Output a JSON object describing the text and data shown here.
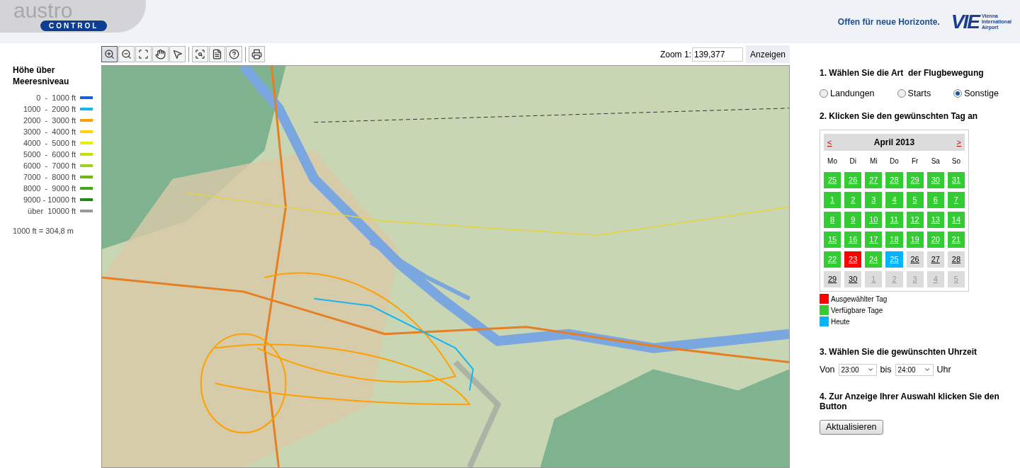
{
  "header": {
    "logo_word": "austro",
    "logo_badge": "CONTROL",
    "slogan": "Offen für neue Horizonte.",
    "airport_logo": "VIE",
    "airport_name": [
      "Vienna",
      "International",
      "Airport"
    ]
  },
  "legend": {
    "title": "Höhe über Meeresniveau",
    "items": [
      {
        "label": "0  -  1000 ft",
        "color": "#1a5fd6"
      },
      {
        "label": "1000  -  2000 ft",
        "color": "#1ab4ef"
      },
      {
        "label": "2000  -  3000 ft",
        "color": "#ffa000"
      },
      {
        "label": "3000  -  4000 ft",
        "color": "#ffd200"
      },
      {
        "label": "4000  -  5000 ft",
        "color": "#e8ee00"
      },
      {
        "label": "5000  -  6000 ft",
        "color": "#c4e000"
      },
      {
        "label": "6000  -  7000 ft",
        "color": "#9ed21e"
      },
      {
        "label": "7000  -  8000 ft",
        "color": "#6eb814"
      },
      {
        "label": "8000  -  9000 ft",
        "color": "#44a814"
      },
      {
        "label": "9000 - 10000 ft",
        "color": "#1e8c14"
      },
      {
        "label": "über  10000 ft",
        "color": "#999999"
      }
    ],
    "note": "1000 ft = 304,8 m"
  },
  "toolbar": {
    "tools": [
      {
        "kind": "zoom_in",
        "selected": true
      },
      {
        "kind": "zoom_out",
        "selected": false
      },
      {
        "kind": "full_extent",
        "selected": false
      },
      {
        "kind": "pan",
        "selected": false
      },
      {
        "kind": "pointer",
        "selected": false
      },
      {
        "kind": "separator"
      },
      {
        "kind": "identify",
        "selected": false
      },
      {
        "kind": "list",
        "selected": false
      },
      {
        "kind": "help",
        "selected": false
      },
      {
        "kind": "separator"
      },
      {
        "kind": "print",
        "selected": false
      }
    ],
    "zoom_label": "Zoom 1:",
    "zoom_value": "139,377",
    "zoom_button": "Anzeigen"
  },
  "panel": {
    "step1": "1. Wählen Sie die Art  der Flugbewegung",
    "movement_types": [
      {
        "label": "Landungen",
        "selected": false
      },
      {
        "label": "Starts",
        "selected": false
      },
      {
        "label": "Sonstige",
        "selected": true
      }
    ],
    "step2": "2. Klicken Sie den gewünschten Tag an",
    "calendar": {
      "prev": "<",
      "title": "April 2013",
      "next": ">",
      "weekdays": [
        "Mo",
        "Di",
        "Mi",
        "Do",
        "Fr",
        "Sa",
        "So"
      ],
      "days": [
        {
          "label": "25",
          "kind": "available"
        },
        {
          "label": "26",
          "kind": "available"
        },
        {
          "label": "27",
          "kind": "available"
        },
        {
          "label": "28",
          "kind": "available"
        },
        {
          "label": "29",
          "kind": "available"
        },
        {
          "label": "30",
          "kind": "available"
        },
        {
          "label": "31",
          "kind": "available"
        },
        {
          "label": "1",
          "kind": "available"
        },
        {
          "label": "2",
          "kind": "available"
        },
        {
          "label": "3",
          "kind": "available"
        },
        {
          "label": "4",
          "kind": "available"
        },
        {
          "label": "5",
          "kind": "available"
        },
        {
          "label": "6",
          "kind": "available"
        },
        {
          "label": "7",
          "kind": "available"
        },
        {
          "label": "8",
          "kind": "available"
        },
        {
          "label": "9",
          "kind": "available"
        },
        {
          "label": "10",
          "kind": "available"
        },
        {
          "label": "11",
          "kind": "available"
        },
        {
          "label": "12",
          "kind": "available"
        },
        {
          "label": "13",
          "kind": "available"
        },
        {
          "label": "14",
          "kind": "available"
        },
        {
          "label": "15",
          "kind": "available"
        },
        {
          "label": "16",
          "kind": "available"
        },
        {
          "label": "17",
          "kind": "available"
        },
        {
          "label": "18",
          "kind": "available"
        },
        {
          "label": "19",
          "kind": "available"
        },
        {
          "label": "20",
          "kind": "available"
        },
        {
          "label": "21",
          "kind": "available"
        },
        {
          "label": "22",
          "kind": "available"
        },
        {
          "label": "23",
          "kind": "selected"
        },
        {
          "label": "24",
          "kind": "available"
        },
        {
          "label": "25",
          "kind": "today"
        },
        {
          "label": "26",
          "kind": "unavailable"
        },
        {
          "label": "27",
          "kind": "unavailable"
        },
        {
          "label": "28",
          "kind": "unavailable"
        },
        {
          "label": "29",
          "kind": "unavailable"
        },
        {
          "label": "30",
          "kind": "unavailable"
        },
        {
          "label": "1",
          "kind": "other_month"
        },
        {
          "label": "2",
          "kind": "other_month"
        },
        {
          "label": "3",
          "kind": "other_month"
        },
        {
          "label": "4",
          "kind": "other_month"
        },
        {
          "label": "5",
          "kind": "other_month"
        }
      ]
    },
    "calendar_legend": [
      {
        "label": "Ausgewählter Tag",
        "color": "#ff0000"
      },
      {
        "label": "Verfügbare Tage",
        "color": "#33cc33"
      },
      {
        "label": "Heute",
        "color": "#00b4ff"
      }
    ],
    "step3": "3. Wählen Sie die gewünschten Uhrzeit",
    "from_label": "Von",
    "from_value": "23:00",
    "to_label": "bis",
    "to_value": "24:00",
    "unit": "Uhr",
    "step4": "4. Zur Anzeige Ihrer Auswahl klicken Sie den Button",
    "submit": "Aktualisieren"
  }
}
